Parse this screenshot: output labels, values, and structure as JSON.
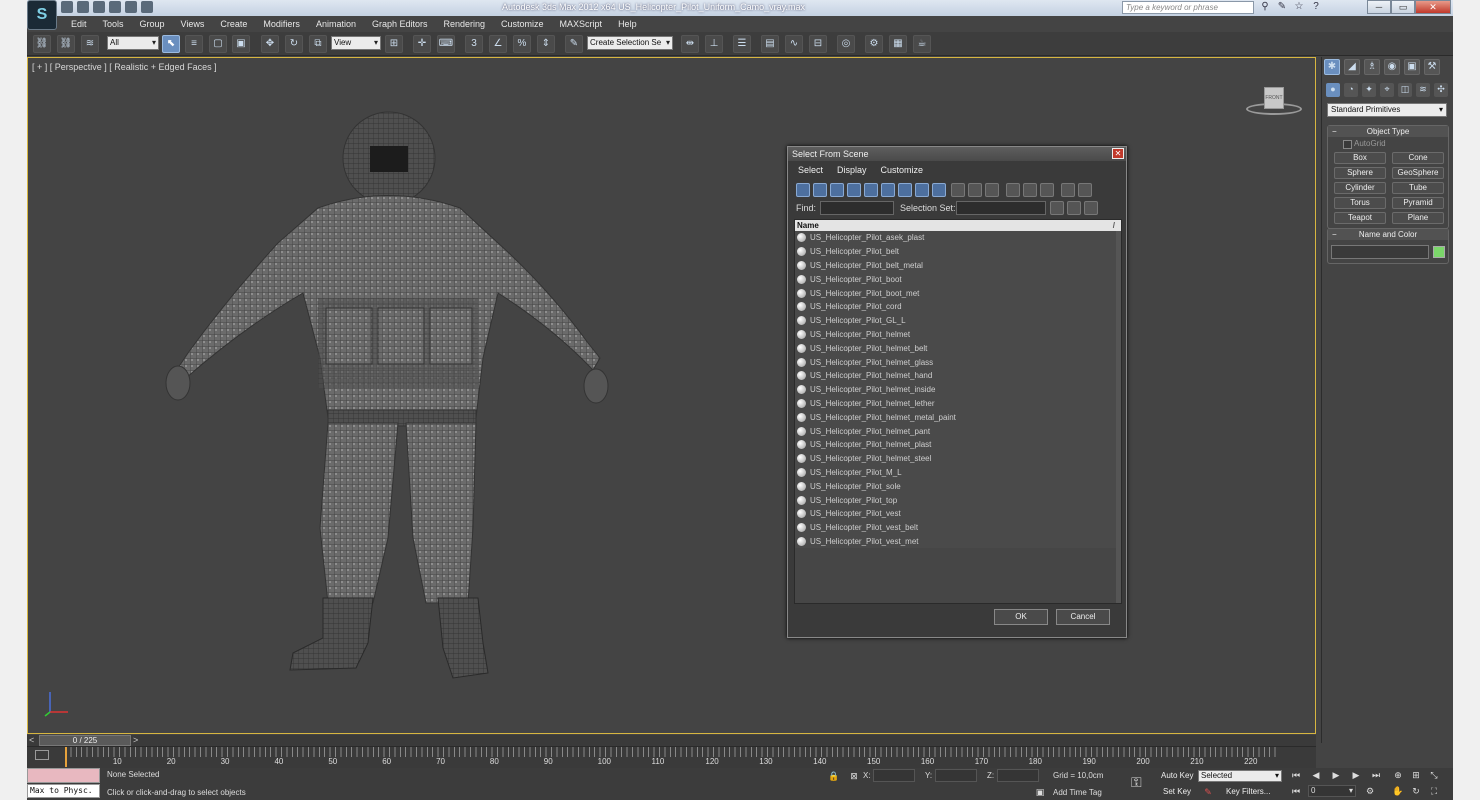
{
  "app": {
    "title": "Autodesk 3ds Max  2012 x64     US_Helicopter_Pilot_Uniform_Camo_vray.max",
    "logo_glyph": "S",
    "search_placeholder": "Type a keyword or phrase",
    "window_controls": [
      "─",
      "▭",
      "✕"
    ]
  },
  "menu": [
    "Edit",
    "Tools",
    "Group",
    "Views",
    "Create",
    "Modifiers",
    "Animation",
    "Graph Editors",
    "Rendering",
    "Customize",
    "MAXScript",
    "Help"
  ],
  "toolbar": {
    "filter_value": "All",
    "ref_coord_value": "View",
    "selection_set_value": "Create Selection Se"
  },
  "viewport": {
    "label": "[ + ] [ Perspective ] [ Realistic + Edged Faces ]",
    "viewcube_label": "FRONT"
  },
  "dialog": {
    "title": "Select From Scene",
    "close_glyph": "✕",
    "menu": [
      "Select",
      "Display",
      "Customize"
    ],
    "find_label": "Find:",
    "selection_set_label": "Selection Set:",
    "column_header": "Name",
    "sort_glyph": "/",
    "items": [
      "US_Helicopter_Pilot_asek_plast",
      "US_Helicopter_Pilot_belt",
      "US_Helicopter_Pilot_belt_metal",
      "US_Helicopter_Pilot_boot",
      "US_Helicopter_Pilot_boot_met",
      "US_Helicopter_Pilot_cord",
      "US_Helicopter_Pilot_GL_L",
      "US_Helicopter_Pilot_helmet",
      "US_Helicopter_Pilot_helmet_belt",
      "US_Helicopter_Pilot_helmet_glass",
      "US_Helicopter_Pilot_helmet_hand",
      "US_Helicopter_Pilot_helmet_inside",
      "US_Helicopter_Pilot_helmet_lether",
      "US_Helicopter_Pilot_helmet_metal_paint",
      "US_Helicopter_Pilot_helmet_pant",
      "US_Helicopter_Pilot_helmet_plast",
      "US_Helicopter_Pilot_helmet_steel",
      "US_Helicopter_Pilot_M_L",
      "US_Helicopter_Pilot_sole",
      "US_Helicopter_Pilot_top",
      "US_Helicopter_Pilot_vest",
      "US_Helicopter_Pilot_vest_belt",
      "US_Helicopter_Pilot_vest_met"
    ],
    "ok_label": "OK",
    "cancel_label": "Cancel"
  },
  "command_panel": {
    "category_value": "Standard Primitives",
    "object_type_title": "Object Type",
    "autogrid_label": "AutoGrid",
    "primitives": [
      "Box",
      "Cone",
      "Sphere",
      "GeoSphere",
      "Cylinder",
      "Tube",
      "Torus",
      "Pyramid",
      "Teapot",
      "Plane"
    ],
    "name_color_title": "Name and Color",
    "object_color": "#7bd66a",
    "rollout_toggle": "−"
  },
  "timeline": {
    "frame_display": "0 / 225",
    "current_frame": 0,
    "total_frames": 225,
    "prev_glyph": "<",
    "next_glyph": ">",
    "tick_labels": [
      "10",
      "20",
      "30",
      "40",
      "50",
      "60",
      "70",
      "80",
      "90",
      "100",
      "110",
      "120",
      "130",
      "140",
      "150",
      "160",
      "170",
      "180",
      "190",
      "200",
      "210",
      "220"
    ]
  },
  "status": {
    "maxscript_listener": "Max to Physc.",
    "selection_status": "None Selected",
    "prompt": "Click or click-and-drag to select objects",
    "x_label": "X:",
    "y_label": "Y:",
    "z_label": "Z:",
    "grid": "Grid = 10,0cm",
    "add_time_tag": "Add Time Tag",
    "auto_key": "Auto Key",
    "set_key": "Set Key",
    "key_mode_value": "Selected",
    "key_filters": "Key Filters...",
    "frame_value": "0"
  }
}
